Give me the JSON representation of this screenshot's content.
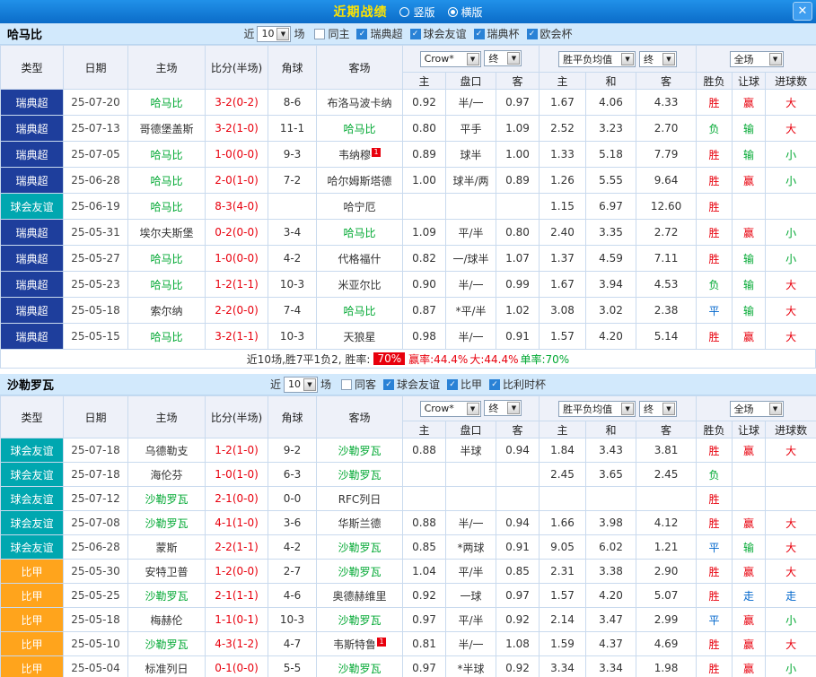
{
  "titlebar": {
    "title": "近期战绩",
    "vertical_label": "竖版",
    "horizontal_label": "横版",
    "selected_layout": "横版",
    "close_glyph": "✕"
  },
  "palette": {
    "vars": {
      "win": "#e8000d",
      "loss": "#00a832",
      "draw": "#0066cc",
      "score": "#e8000d",
      "team-hl": "#00a832",
      "title-yellow": "#ffe400"
    },
    "league_colors": {
      "瑞典超": "#1e3e9c",
      "球会友谊": "#00a7b0",
      "比甲": "#ffa41c"
    }
  },
  "table_header": {
    "main_cols": [
      "类型",
      "日期",
      "主场",
      "比分(半场)",
      "角球",
      "客场"
    ],
    "sub_cols": [
      "主",
      "盘口",
      "客",
      "主",
      "和",
      "客",
      "胜负",
      "让球",
      "进球数"
    ],
    "selects": {
      "company": "Crow*",
      "company_final": "终",
      "avg": "胜平负均值",
      "avg_final": "终",
      "scope": "全场"
    }
  },
  "sections": [
    {
      "team": "哈马比",
      "filter": {
        "near_label": "近",
        "count": "10",
        "unit_label": "场",
        "checkboxes": [
          {
            "label": "同主",
            "checked": false
          },
          {
            "label": "瑞典超",
            "checked": true
          },
          {
            "label": "球会友谊",
            "checked": true
          },
          {
            "label": "瑞典杯",
            "checked": true
          },
          {
            "label": "欧会杯",
            "checked": true
          }
        ]
      },
      "rows": [
        {
          "league": "瑞典超",
          "date": "25-07-20",
          "home": "哈马比",
          "home_hl": true,
          "score": "3-2(0-2)",
          "corner": "8-6",
          "away": "布洛马波卡纳",
          "odds": [
            "0.92",
            "半/一",
            "0.97"
          ],
          "avg": [
            "1.67",
            "4.06",
            "4.33"
          ],
          "results": [
            {
              "text": "胜",
              "kind": "win"
            },
            {
              "text": "赢",
              "kind": "win"
            },
            {
              "text": "大",
              "kind": "win"
            }
          ]
        },
        {
          "league": "瑞典超",
          "date": "25-07-13",
          "home": "哥德堡盖斯",
          "score": "3-2(1-0)",
          "corner": "11-1",
          "away": "哈马比",
          "away_hl": true,
          "odds": [
            "0.80",
            "平手",
            "1.09"
          ],
          "avg": [
            "2.52",
            "3.23",
            "2.70"
          ],
          "results": [
            {
              "text": "负",
              "kind": "loss"
            },
            {
              "text": "输",
              "kind": "loss"
            },
            {
              "text": "大",
              "kind": "win"
            }
          ]
        },
        {
          "league": "瑞典超",
          "date": "25-07-05",
          "home": "哈马比",
          "home_hl": true,
          "score": "1-0(0-0)",
          "corner": "9-3",
          "away": "韦纳穆",
          "away_badge": "1",
          "odds": [
            "0.89",
            "球半",
            "1.00"
          ],
          "avg": [
            "1.33",
            "5.18",
            "7.79"
          ],
          "results": [
            {
              "text": "胜",
              "kind": "win"
            },
            {
              "text": "输",
              "kind": "loss"
            },
            {
              "text": "小",
              "kind": "loss"
            }
          ]
        },
        {
          "league": "瑞典超",
          "date": "25-06-28",
          "home": "哈马比",
          "home_hl": true,
          "score": "2-0(1-0)",
          "corner": "7-2",
          "away": "哈尔姆斯塔德",
          "odds": [
            "1.00",
            "球半/两",
            "0.89"
          ],
          "avg": [
            "1.26",
            "5.55",
            "9.64"
          ],
          "results": [
            {
              "text": "胜",
              "kind": "win"
            },
            {
              "text": "赢",
              "kind": "win"
            },
            {
              "text": "小",
              "kind": "loss"
            }
          ]
        },
        {
          "league": "球会友谊",
          "date": "25-06-19",
          "home": "哈马比",
          "home_hl": true,
          "score": "8-3(4-0)",
          "corner": "",
          "away": "哈宁厄",
          "odds": [
            "",
            "",
            ""
          ],
          "avg": [
            "1.15",
            "6.97",
            "12.60"
          ],
          "results": [
            {
              "text": "胜",
              "kind": "win"
            },
            {
              "text": "",
              "kind": "plain"
            },
            {
              "text": "",
              "kind": "plain"
            }
          ]
        },
        {
          "league": "瑞典超",
          "date": "25-05-31",
          "home": "埃尔夫斯堡",
          "score": "0-2(0-0)",
          "corner": "3-4",
          "away": "哈马比",
          "away_hl": true,
          "odds": [
            "1.09",
            "平/半",
            "0.80"
          ],
          "avg": [
            "2.40",
            "3.35",
            "2.72"
          ],
          "results": [
            {
              "text": "胜",
              "kind": "win"
            },
            {
              "text": "赢",
              "kind": "win"
            },
            {
              "text": "小",
              "kind": "loss"
            }
          ]
        },
        {
          "league": "瑞典超",
          "date": "25-05-27",
          "home": "哈马比",
          "home_hl": true,
          "score": "1-0(0-0)",
          "corner": "4-2",
          "away": "代格福什",
          "odds": [
            "0.82",
            "一/球半",
            "1.07"
          ],
          "avg": [
            "1.37",
            "4.59",
            "7.11"
          ],
          "results": [
            {
              "text": "胜",
              "kind": "win"
            },
            {
              "text": "输",
              "kind": "loss"
            },
            {
              "text": "小",
              "kind": "loss"
            }
          ]
        },
        {
          "league": "瑞典超",
          "date": "25-05-23",
          "home": "哈马比",
          "home_hl": true,
          "score": "1-2(1-1)",
          "corner": "10-3",
          "away": "米亚尔比",
          "odds": [
            "0.90",
            "半/一",
            "0.99"
          ],
          "avg": [
            "1.67",
            "3.94",
            "4.53"
          ],
          "results": [
            {
              "text": "负",
              "kind": "loss"
            },
            {
              "text": "输",
              "kind": "loss"
            },
            {
              "text": "大",
              "kind": "win"
            }
          ]
        },
        {
          "league": "瑞典超",
          "date": "25-05-18",
          "home": "索尔纳",
          "score": "2-2(0-0)",
          "corner": "7-4",
          "away": "哈马比",
          "away_hl": true,
          "odds": [
            "0.87",
            "*平/半",
            "1.02"
          ],
          "avg": [
            "3.08",
            "3.02",
            "2.38"
          ],
          "results": [
            {
              "text": "平",
              "kind": "draw"
            },
            {
              "text": "输",
              "kind": "loss"
            },
            {
              "text": "大",
              "kind": "win"
            }
          ]
        },
        {
          "league": "瑞典超",
          "date": "25-05-15",
          "home": "哈马比",
          "home_hl": true,
          "score": "3-2(1-1)",
          "corner": "10-3",
          "away": "天狼星",
          "odds": [
            "0.98",
            "半/一",
            "0.91"
          ],
          "avg": [
            "1.57",
            "4.20",
            "5.14"
          ],
          "results": [
            {
              "text": "胜",
              "kind": "win"
            },
            {
              "text": "赢",
              "kind": "win"
            },
            {
              "text": "大",
              "kind": "win"
            }
          ]
        }
      ],
      "summary": [
        {
          "text": "近10场,胜7平1负2, 胜率: ",
          "style": "plain"
        },
        {
          "text": "70%",
          "style": "badge"
        },
        {
          "text": " 赢率:44.4%",
          "style": "red"
        },
        {
          "text": " 大:44.4%",
          "style": "red"
        },
        {
          "text": " 单率:70%",
          "style": "green"
        }
      ]
    },
    {
      "team": "沙勒罗瓦",
      "filter": {
        "near_label": "近",
        "count": "10",
        "unit_label": "场",
        "checkboxes": [
          {
            "label": "同客",
            "checked": false
          },
          {
            "label": "球会友谊",
            "checked": true
          },
          {
            "label": "比甲",
            "checked": true
          },
          {
            "label": "比利时杯",
            "checked": true
          }
        ]
      },
      "rows": [
        {
          "league": "球会友谊",
          "date": "25-07-18",
          "home": "乌德勒支",
          "score": "1-2(1-0)",
          "corner": "9-2",
          "away": "沙勒罗瓦",
          "away_hl": true,
          "odds": [
            "0.88",
            "半球",
            "0.94"
          ],
          "avg": [
            "1.84",
            "3.43",
            "3.81"
          ],
          "results": [
            {
              "text": "胜",
              "kind": "win"
            },
            {
              "text": "赢",
              "kind": "win"
            },
            {
              "text": "大",
              "kind": "win"
            }
          ]
        },
        {
          "league": "球会友谊",
          "date": "25-07-18",
          "home": "海伦芬",
          "score": "1-0(1-0)",
          "corner": "6-3",
          "away": "沙勒罗瓦",
          "away_hl": true,
          "odds": [
            "",
            "",
            ""
          ],
          "avg": [
            "2.45",
            "3.65",
            "2.45"
          ],
          "results": [
            {
              "text": "负",
              "kind": "loss"
            },
            {
              "text": "",
              "kind": "plain"
            },
            {
              "text": "",
              "kind": "plain"
            }
          ]
        },
        {
          "league": "球会友谊",
          "date": "25-07-12",
          "home": "沙勒罗瓦",
          "home_hl": true,
          "score": "2-1(0-0)",
          "corner": "0-0",
          "away": "RFC列日",
          "odds": [
            "",
            "",
            ""
          ],
          "avg": [
            "",
            "",
            ""
          ],
          "results": [
            {
              "text": "胜",
              "kind": "win"
            },
            {
              "text": "",
              "kind": "plain"
            },
            {
              "text": "",
              "kind": "plain"
            }
          ]
        },
        {
          "league": "球会友谊",
          "date": "25-07-08",
          "home": "沙勒罗瓦",
          "home_hl": true,
          "score": "4-1(1-0)",
          "corner": "3-6",
          "away": "华斯兰德",
          "odds": [
            "0.88",
            "半/一",
            "0.94"
          ],
          "avg": [
            "1.66",
            "3.98",
            "4.12"
          ],
          "results": [
            {
              "text": "胜",
              "kind": "win"
            },
            {
              "text": "赢",
              "kind": "win"
            },
            {
              "text": "大",
              "kind": "win"
            }
          ]
        },
        {
          "league": "球会友谊",
          "date": "25-06-28",
          "home": "蒙斯",
          "score": "2-2(1-1)",
          "corner": "4-2",
          "away": "沙勒罗瓦",
          "away_hl": true,
          "odds": [
            "0.85",
            "*两球",
            "0.91"
          ],
          "avg": [
            "9.05",
            "6.02",
            "1.21"
          ],
          "results": [
            {
              "text": "平",
              "kind": "draw"
            },
            {
              "text": "输",
              "kind": "loss"
            },
            {
              "text": "大",
              "kind": "win"
            }
          ]
        },
        {
          "league": "比甲",
          "date": "25-05-30",
          "home": "安特卫普",
          "score": "1-2(0-0)",
          "corner": "2-7",
          "away": "沙勒罗瓦",
          "away_hl": true,
          "odds": [
            "1.04",
            "平/半",
            "0.85"
          ],
          "avg": [
            "2.31",
            "3.38",
            "2.90"
          ],
          "results": [
            {
              "text": "胜",
              "kind": "win"
            },
            {
              "text": "赢",
              "kind": "win"
            },
            {
              "text": "大",
              "kind": "win"
            }
          ]
        },
        {
          "league": "比甲",
          "date": "25-05-25",
          "home": "沙勒罗瓦",
          "home_hl": true,
          "score": "2-1(1-1)",
          "corner": "4-6",
          "away": "奥德赫维里",
          "odds": [
            "0.92",
            "一球",
            "0.97"
          ],
          "avg": [
            "1.57",
            "4.20",
            "5.07"
          ],
          "results": [
            {
              "text": "胜",
              "kind": "win"
            },
            {
              "text": "走",
              "kind": "draw"
            },
            {
              "text": "走",
              "kind": "draw"
            }
          ]
        },
        {
          "league": "比甲",
          "date": "25-05-18",
          "home": "梅赫伦",
          "score": "1-1(0-1)",
          "corner": "10-3",
          "away": "沙勒罗瓦",
          "away_hl": true,
          "odds": [
            "0.97",
            "平/半",
            "0.92"
          ],
          "avg": [
            "2.14",
            "3.47",
            "2.99"
          ],
          "results": [
            {
              "text": "平",
              "kind": "draw"
            },
            {
              "text": "赢",
              "kind": "win"
            },
            {
              "text": "小",
              "kind": "loss"
            }
          ]
        },
        {
          "league": "比甲",
          "date": "25-05-10",
          "home": "沙勒罗瓦",
          "home_hl": true,
          "score": "4-3(1-2)",
          "corner": "4-7",
          "away": "韦斯特鲁",
          "away_badge": "1",
          "odds": [
            "0.81",
            "半/一",
            "1.08"
          ],
          "avg": [
            "1.59",
            "4.37",
            "4.69"
          ],
          "results": [
            {
              "text": "胜",
              "kind": "win"
            },
            {
              "text": "赢",
              "kind": "win"
            },
            {
              "text": "大",
              "kind": "win"
            }
          ]
        },
        {
          "league": "比甲",
          "date": "25-05-04",
          "home": "标准列日",
          "score": "0-1(0-0)",
          "corner": "5-5",
          "away": "沙勒罗瓦",
          "away_hl": true,
          "odds": [
            "0.97",
            "*半球",
            "0.92"
          ],
          "avg": [
            "3.34",
            "3.34",
            "1.98"
          ],
          "results": [
            {
              "text": "胜",
              "kind": "win"
            },
            {
              "text": "赢",
              "kind": "win"
            },
            {
              "text": "小",
              "kind": "loss"
            }
          ]
        }
      ],
      "summary": []
    }
  ]
}
